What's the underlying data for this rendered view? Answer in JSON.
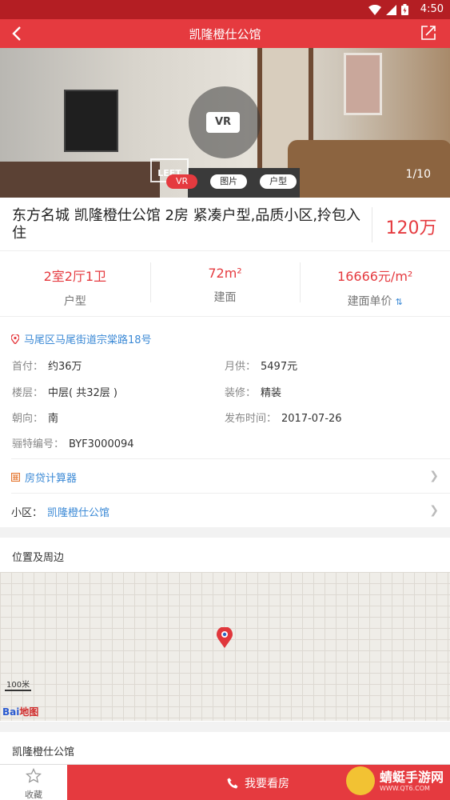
{
  "status_bar": {
    "time": "4:50"
  },
  "nav": {
    "title": "凯隆橙仕公馆"
  },
  "gallery": {
    "vr_badge": "VR",
    "logo_text": "LEET",
    "counter": "1/10",
    "tabs": [
      {
        "label": "VR",
        "active": true
      },
      {
        "label": "图片",
        "active": false
      },
      {
        "label": "户型",
        "active": false
      }
    ]
  },
  "listing": {
    "title": "东方名城 凯隆橙仕公馆 2房 紧凑户型,品质小区,拎包入住",
    "price": "120万"
  },
  "stats": [
    {
      "value": "2室2厅1卫",
      "label": "户型"
    },
    {
      "value": "72m²",
      "label": "建面"
    },
    {
      "value": "16666元/m²",
      "label": "建面单价"
    }
  ],
  "details": {
    "address": "马尾区马尾街道宗棠路18号",
    "down_payment_label": "首付：",
    "down_payment": "约36万",
    "monthly_label": "月供：",
    "monthly": "5497元",
    "floor_label": "楼层：",
    "floor": "中层( 共32层 )",
    "decoration_label": "装修：",
    "decoration": "精装",
    "orientation_label": "朝向：",
    "orientation": "南",
    "publish_label": "发布时间：",
    "publish": "2017-07-26",
    "code_label": "骊特编号：",
    "code": "BYF3000094",
    "calculator": "房贷计算器",
    "community_label": "小区：",
    "community": "凯隆橙仕公馆"
  },
  "map_section": {
    "title": "位置及周边",
    "scale": "100米",
    "brand_a": "Bai",
    "brand_b": "地图"
  },
  "community_section": {
    "title": "凯隆橙仕公馆"
  },
  "bottom": {
    "favorite": "收藏",
    "call": "我要看房",
    "watermark": "蜻蜓手游网",
    "watermark_url": "WWW.QT6.COM"
  },
  "colors": {
    "brand_red": "#e53a3f",
    "link_blue": "#3c8ad6",
    "status_bar": "#b41e23"
  }
}
